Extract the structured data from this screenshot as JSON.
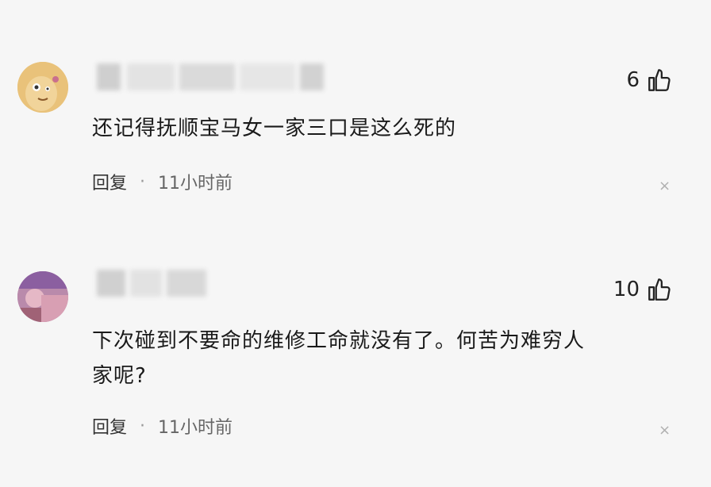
{
  "comments": [
    {
      "likes": "6",
      "text": "还记得抚顺宝马女一家三口是这么死的",
      "reply_label": "回复",
      "separator": "·",
      "time": "11小时前",
      "close_symbol": "×"
    },
    {
      "likes": "10",
      "text_line1": "下次碰到不要命的维修工命就没有了。何苦为难穷人",
      "text_line2": "家呢?",
      "reply_label": "回复",
      "separator": "·",
      "time": "11小时前",
      "close_symbol": "×"
    }
  ],
  "icons": {
    "like": "thumbs-up-icon",
    "close": "close-icon"
  }
}
